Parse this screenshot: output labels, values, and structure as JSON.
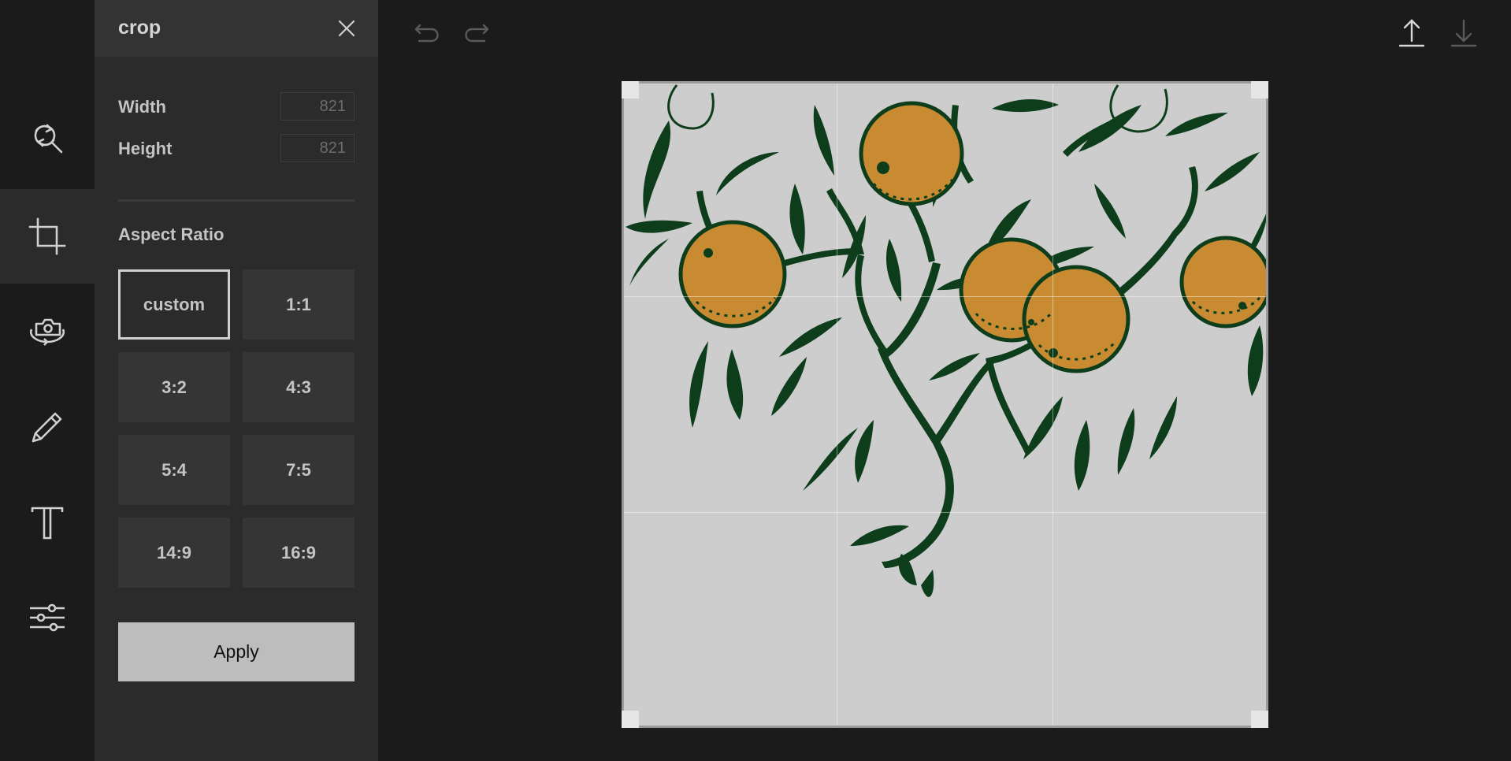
{
  "rail": {
    "items": [
      {
        "icon": "search-replace-icon"
      },
      {
        "icon": "crop-icon",
        "active": true
      },
      {
        "icon": "camera-rotate-icon"
      },
      {
        "icon": "pencil-icon"
      },
      {
        "icon": "text-icon"
      },
      {
        "icon": "sliders-icon"
      }
    ]
  },
  "panel": {
    "title": "crop",
    "width_label": "Width",
    "width_value": "821",
    "height_label": "Height",
    "height_value": "821",
    "aspect_label": "Aspect Ratio",
    "ratios": [
      "custom",
      "1:1",
      "3:2",
      "4:3",
      "5:4",
      "7:5",
      "14:9",
      "16:9"
    ],
    "selected_ratio": "custom",
    "apply_label": "Apply"
  },
  "toolbar": {
    "undo_icon": "undo-icon",
    "redo_icon": "redo-icon",
    "upload_icon": "upload-icon",
    "download_icon": "download-icon"
  },
  "colors": {
    "leaf": "#0d3d1b",
    "fruit": "#c98b32",
    "canvas_bg": "#cdcdcd",
    "panel_bg": "#2b2b2b"
  }
}
